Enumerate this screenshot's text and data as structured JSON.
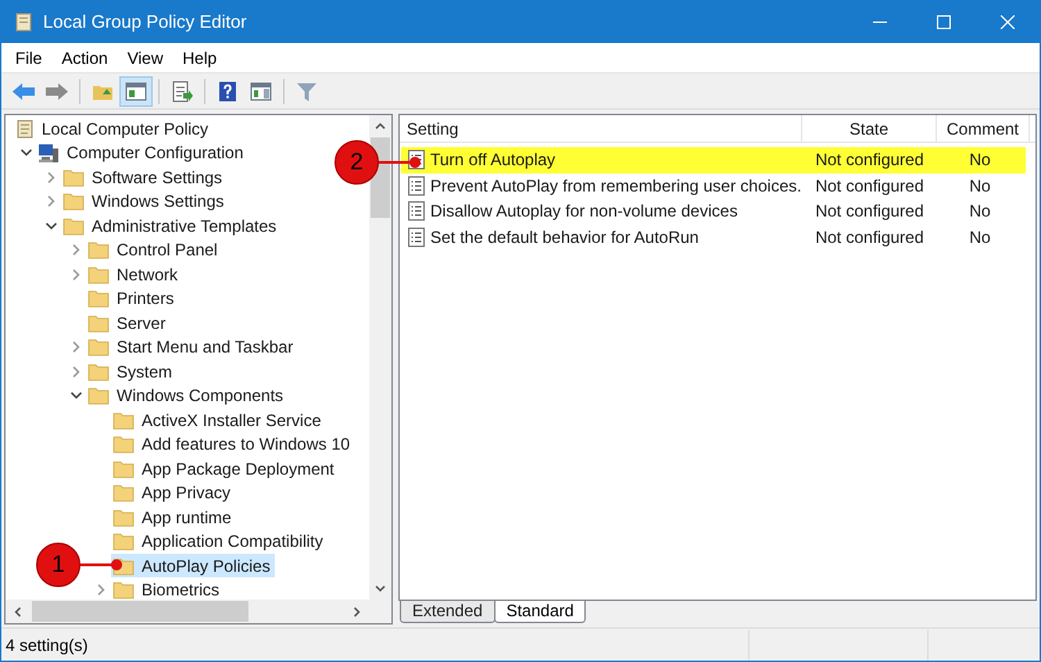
{
  "window": {
    "title": "Local Group Policy Editor"
  },
  "menu": [
    "File",
    "Action",
    "View",
    "Help"
  ],
  "toolbar": [
    [
      {
        "kind": "back",
        "pressed": false
      },
      {
        "kind": "forward",
        "pressed": false
      }
    ],
    [
      {
        "kind": "up",
        "pressed": false
      },
      {
        "kind": "tree",
        "pressed": true
      }
    ],
    [
      {
        "kind": "export",
        "pressed": false
      }
    ],
    [
      {
        "kind": "help",
        "pressed": false
      },
      {
        "kind": "pane",
        "pressed": false
      }
    ],
    [
      {
        "kind": "filter",
        "pressed": false
      }
    ]
  ],
  "tree": [
    {
      "label": "Local Computer Policy",
      "kind": "policy",
      "selected": false,
      "children": [
        {
          "label": "Computer Configuration",
          "kind": "computer",
          "expanded": true,
          "selected": false,
          "children": [
            {
              "label": "Software Settings",
              "kind": "folder",
              "expanded": false,
              "selected": false
            },
            {
              "label": "Windows Settings",
              "kind": "folder",
              "expanded": false,
              "selected": false
            },
            {
              "label": "Administrative Templates",
              "kind": "folder",
              "expanded": true,
              "selected": false,
              "children": [
                {
                  "label": "Control Panel",
                  "kind": "folder",
                  "expanded": false,
                  "selected": false
                },
                {
                  "label": "Network",
                  "kind": "folder",
                  "expanded": false,
                  "selected": false
                },
                {
                  "label": "Printers",
                  "kind": "folder",
                  "selected": false
                },
                {
                  "label": "Server",
                  "kind": "folder",
                  "selected": false
                },
                {
                  "label": "Start Menu and Taskbar",
                  "kind": "folder",
                  "expanded": false,
                  "selected": false
                },
                {
                  "label": "System",
                  "kind": "folder",
                  "expanded": false,
                  "selected": false
                },
                {
                  "label": "Windows Components",
                  "kind": "folder",
                  "expanded": true,
                  "selected": false,
                  "children": [
                    {
                      "label": "ActiveX Installer Service",
                      "kind": "folder",
                      "selected": false
                    },
                    {
                      "label": "Add features to Windows 10",
                      "kind": "folder",
                      "selected": false
                    },
                    {
                      "label": "App Package Deployment",
                      "kind": "folder",
                      "selected": false
                    },
                    {
                      "label": "App Privacy",
                      "kind": "folder",
                      "selected": false
                    },
                    {
                      "label": "App runtime",
                      "kind": "folder",
                      "selected": false
                    },
                    {
                      "label": "Application Compatibility",
                      "kind": "folder",
                      "selected": false
                    },
                    {
                      "label": "AutoPlay Policies",
                      "kind": "folder",
                      "selected": true
                    },
                    {
                      "label": "Biometrics",
                      "kind": "folder",
                      "expanded": false,
                      "selected": false
                    }
                  ]
                }
              ]
            }
          ]
        }
      ]
    }
  ],
  "table": {
    "columns": [
      "Setting",
      "State",
      "Comment"
    ],
    "rows": [
      {
        "setting": "Turn off Autoplay",
        "state": "Not configured",
        "comment": "No",
        "highlighted": true
      },
      {
        "setting": "Prevent AutoPlay from remembering user choices.",
        "state": "Not configured",
        "comment": "No",
        "highlighted": false
      },
      {
        "setting": "Disallow Autoplay for non-volume devices",
        "state": "Not configured",
        "comment": "No",
        "highlighted": false
      },
      {
        "setting": "Set the default behavior for AutoRun",
        "state": "Not configured",
        "comment": "No",
        "highlighted": false
      }
    ]
  },
  "view_tabs": [
    {
      "label": "Extended",
      "selected": false
    },
    {
      "label": "Standard",
      "selected": true
    }
  ],
  "annotations": [
    {
      "label": "1"
    },
    {
      "label": "2"
    }
  ],
  "status_bar": {
    "text": "4 setting(s)"
  }
}
